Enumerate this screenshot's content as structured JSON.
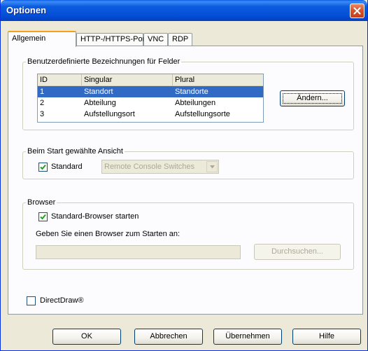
{
  "window": {
    "title": "Optionen"
  },
  "tabs": [
    {
      "label": "Allgemein",
      "active": true
    },
    {
      "label": "HTTP-/HTTPS-Ports",
      "active": false
    },
    {
      "label": "VNC",
      "active": false
    },
    {
      "label": "RDP",
      "active": false
    }
  ],
  "fields_group": {
    "title": "Benutzerdefinierte Bezeichnungen für Felder",
    "columns": [
      "ID",
      "Singular",
      "Plural"
    ],
    "rows": [
      {
        "id": "1",
        "singular": "Standort",
        "plural": "Standorte",
        "selected": true
      },
      {
        "id": "2",
        "singular": "Abteilung",
        "plural": "Abteilungen",
        "selected": false
      },
      {
        "id": "3",
        "singular": "Aufstellungsort",
        "plural": "Aufstellungsorte",
        "selected": false
      }
    ],
    "edit_button": "Ändern..."
  },
  "start_view_group": {
    "title": "Beim Start gewählte Ansicht",
    "standard_label": "Standard",
    "standard_checked": true,
    "view_select_value": "Remote Console Switches"
  },
  "browser_group": {
    "title": "Browser",
    "default_browser_label": "Standard-Browser starten",
    "default_browser_checked": true,
    "specify_label": "Geben Sie einen Browser zum Starten an:",
    "path_value": "",
    "browse_button": "Durchsuchen..."
  },
  "directdraw": {
    "label": "DirectDraw®",
    "checked": false
  },
  "footer": {
    "ok": "OK",
    "cancel": "Abbrechen",
    "apply": "Übernehmen",
    "help": "Hilfe"
  },
  "colors": {
    "titlebar": "#0450d8",
    "selection": "#316ac5",
    "tab_accent": "#f3a21a",
    "dialog_bg": "#ece9d8"
  }
}
